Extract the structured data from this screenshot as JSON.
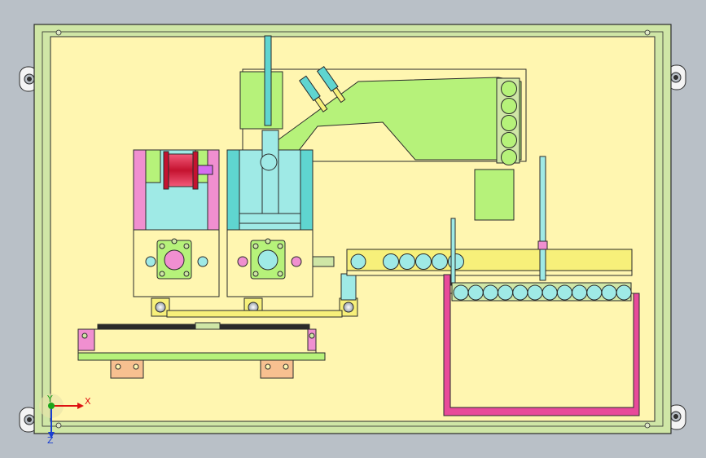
{
  "axes": {
    "x_label": "X",
    "y_label": "Y",
    "z_label": "Z"
  },
  "colors": {
    "background": "#b9c0c7",
    "plate": "#fff6b0",
    "frame": "#cfe6a6",
    "green": "#b6f27a",
    "cyan": "#9feae6",
    "teal": "#5fd5d0",
    "pink": "#f08fd0",
    "magenta": "#e84a9a",
    "red": "#d8183e",
    "yellow": "#f7f07a",
    "outline": "#2a2a2a"
  },
  "counts": {
    "arm_rollers": 5,
    "chute_rollers": 6,
    "tray_rollers": 12
  }
}
